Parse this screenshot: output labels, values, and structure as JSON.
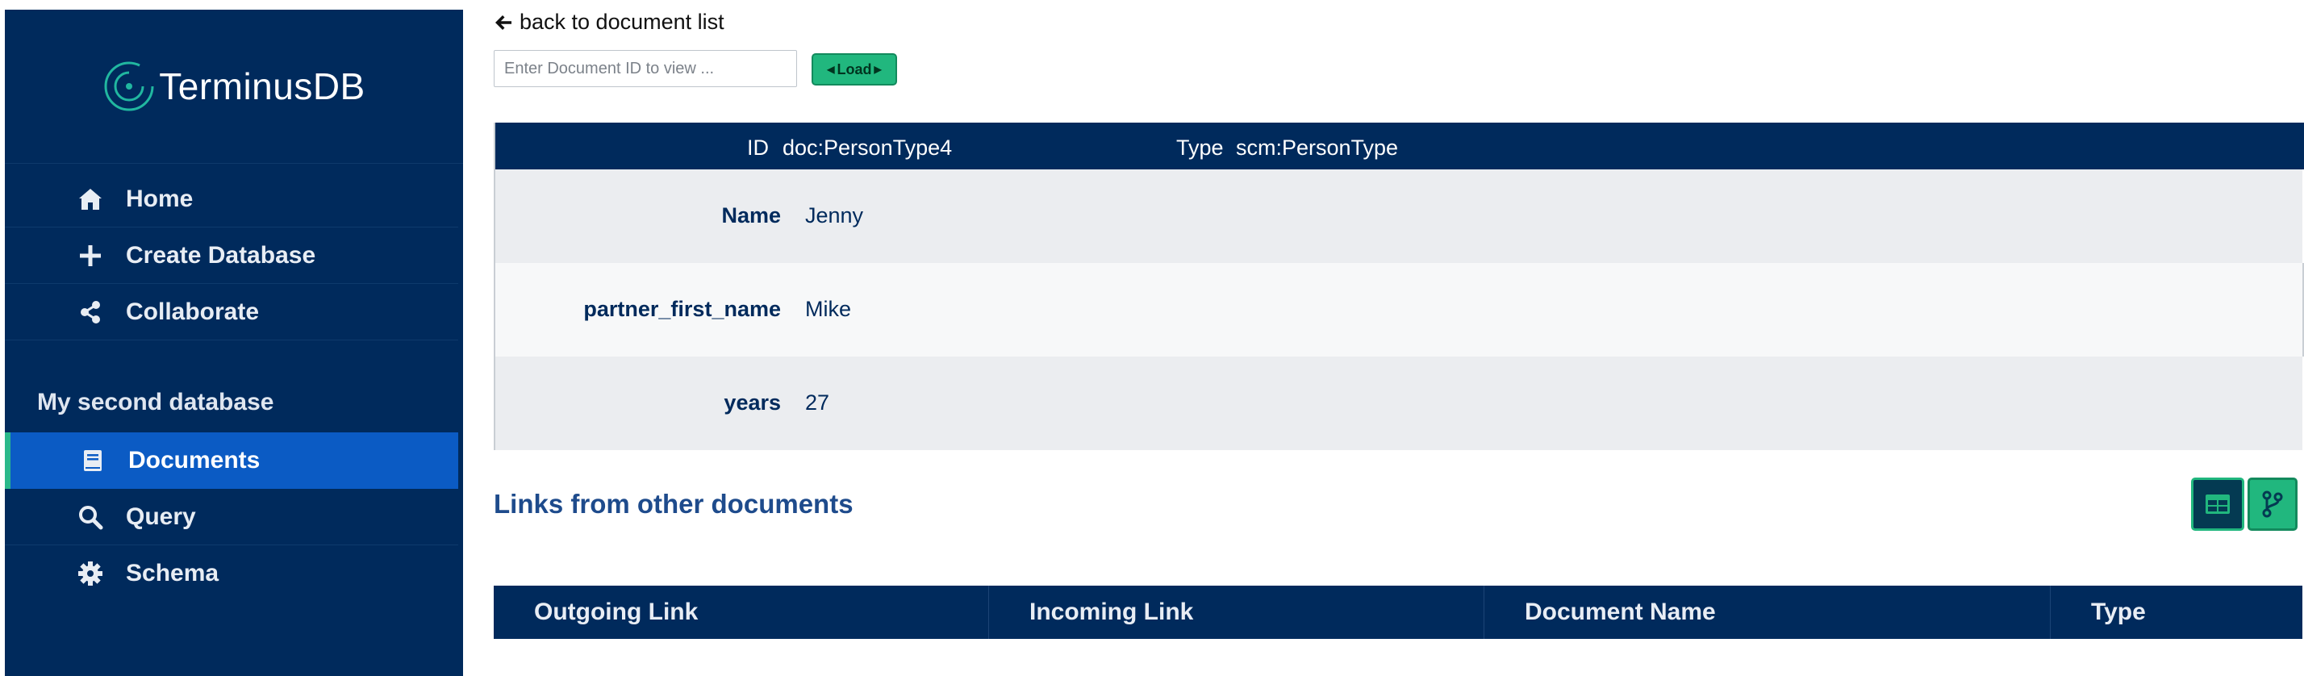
{
  "sidebar": {
    "logo_text": "TerminusDB",
    "nav": [
      {
        "label": "Home",
        "icon": "home-icon"
      },
      {
        "label": "Create Database",
        "icon": "plus-icon"
      },
      {
        "label": "Collaborate",
        "icon": "share-icon"
      }
    ],
    "database_name": "My second database",
    "db_nav": [
      {
        "label": "Documents",
        "icon": "book-icon",
        "active": true
      },
      {
        "label": "Query",
        "icon": "search-icon"
      },
      {
        "label": "Schema",
        "icon": "gear-icon"
      }
    ]
  },
  "main": {
    "back_link": "back to document list",
    "doc_id_placeholder": "Enter Document ID to view ...",
    "load_label": "Load",
    "document": {
      "id_label": "ID",
      "id_value": "doc:PersonType4",
      "type_label": "Type",
      "type_value": "scm:PersonType",
      "fields": [
        {
          "key": "Name",
          "value": "Jenny"
        },
        {
          "key": "partner_first_name",
          "value": "Mike"
        },
        {
          "key": "years",
          "value": "27"
        }
      ]
    },
    "links_title": "Links from other documents",
    "links_columns": [
      "Outgoing Link",
      "Incoming Link",
      "Document Name",
      "Type"
    ]
  },
  "colors": {
    "sidebar_bg": "#002a5c",
    "active_bg": "#0b5bc4",
    "accent_green": "#21b77e",
    "row_alt": "#ebedf0"
  }
}
